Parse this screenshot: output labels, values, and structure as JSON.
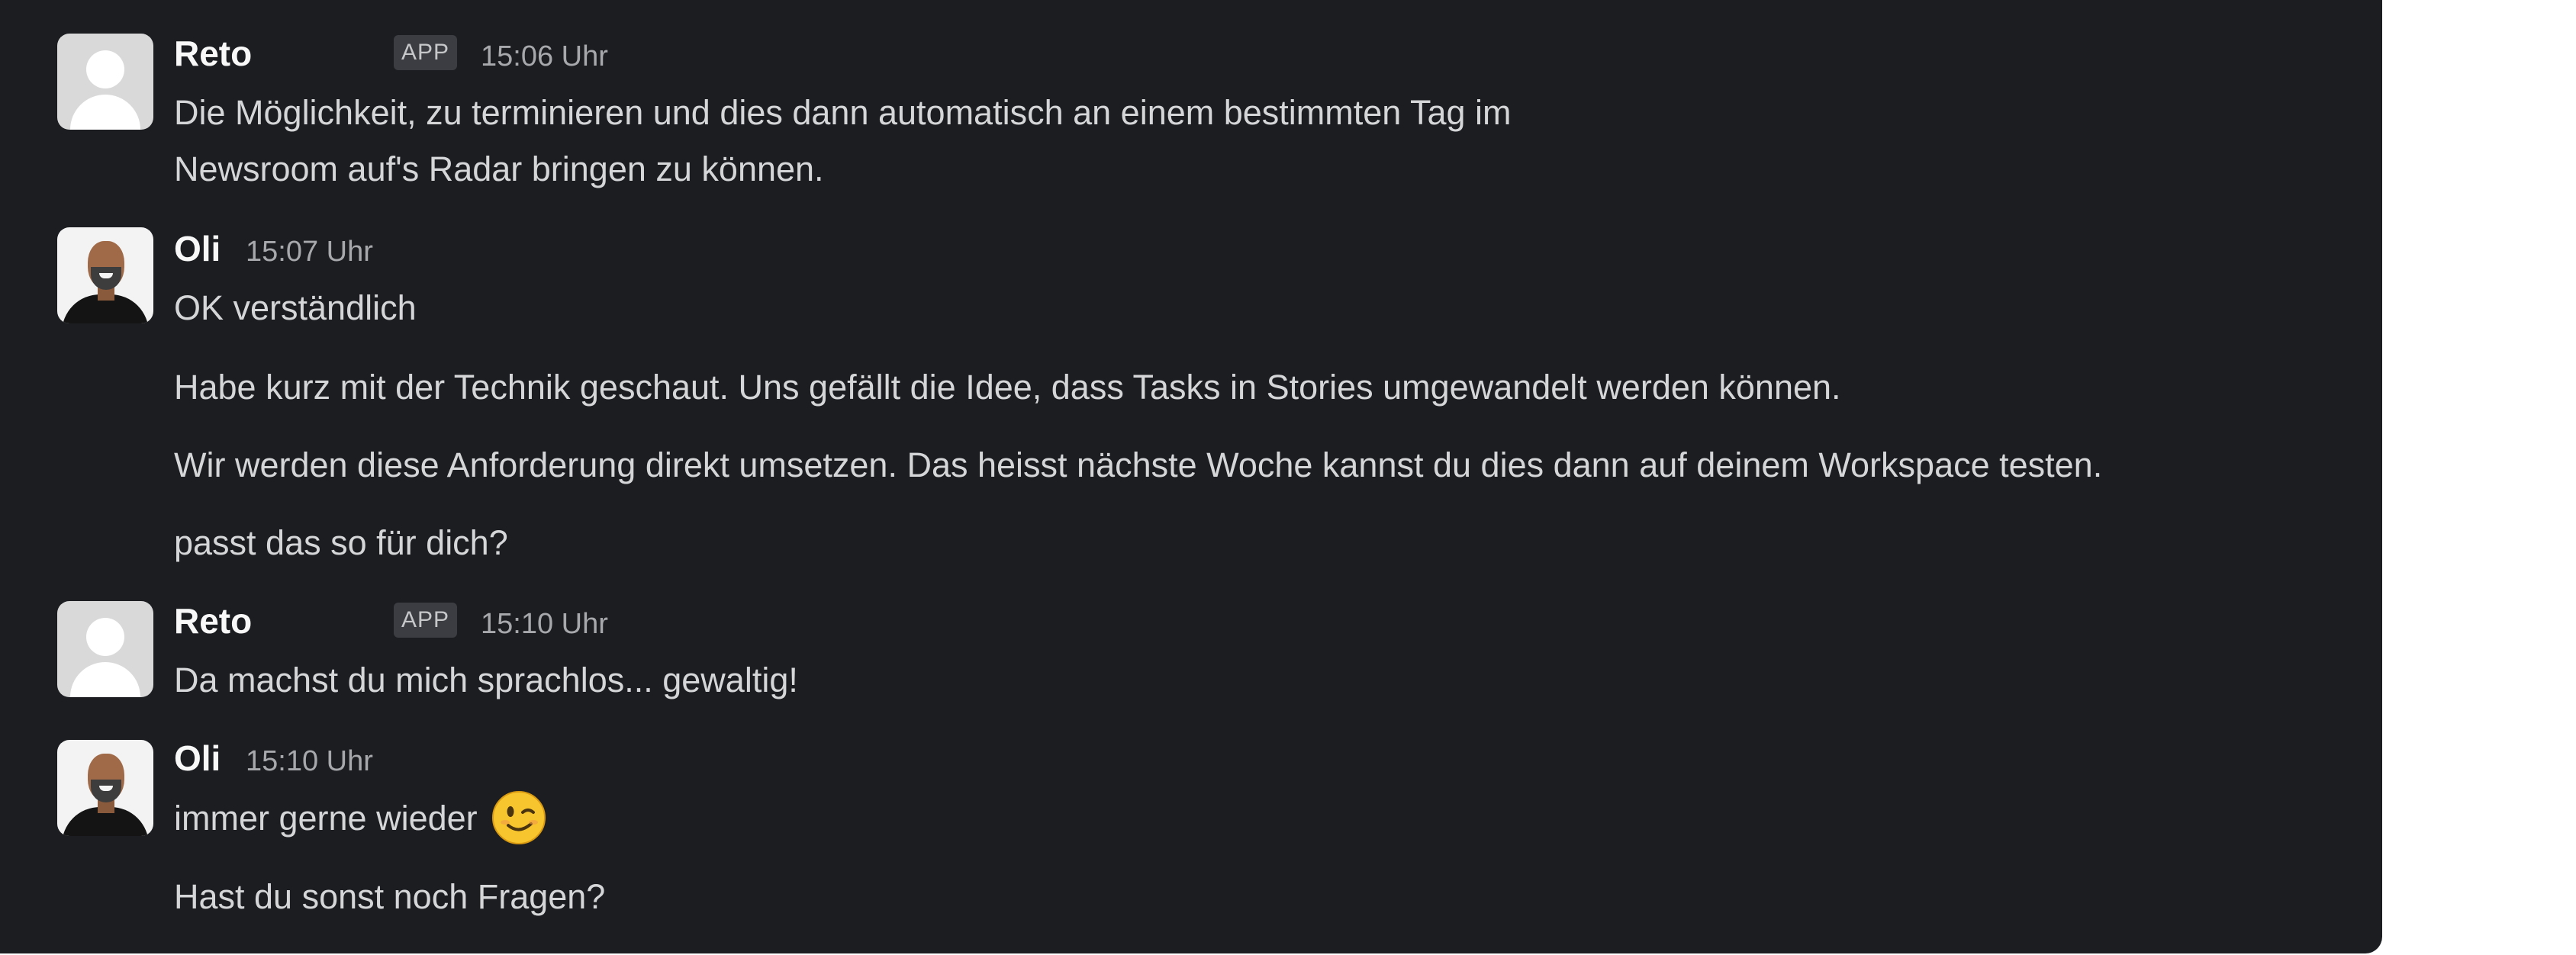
{
  "messages": [
    {
      "sender": "Reto",
      "badge": "APP",
      "time": "15:06 Uhr",
      "lines": [
        "Die Möglichkeit, zu terminieren und dies dann automatisch an einem bestimmten Tag im",
        "Newsroom auf's Radar bringen zu können."
      ]
    },
    {
      "sender": "Oli",
      "time": "15:07 Uhr",
      "lines": [
        "OK verständlich",
        "Habe kurz mit der Technik geschaut. Uns gefällt die Idee, dass Tasks in Stories umgewandelt werden können.",
        "Wir werden diese Anforderung direkt umsetzen. Das heisst nächste Woche kannst du dies dann auf deinem Workspace testen.",
        "passt das so für dich?"
      ]
    },
    {
      "sender": "Reto",
      "badge": "APP",
      "time": "15:10 Uhr",
      "lines": [
        "Da machst du mich sprachlos... gewaltig!"
      ]
    },
    {
      "sender": "Oli",
      "time": "15:10 Uhr",
      "lines": [
        "immer gerne wieder",
        "Hast du sonst noch Fragen?"
      ],
      "emoji": "winking-face-emoji"
    }
  ],
  "colors": {
    "background": "#1b1d21",
    "name": "#f8f8f8",
    "text": "#d5d6d8",
    "timestamp": "#a7a8ab",
    "badge_bg": "#3b3d42"
  }
}
